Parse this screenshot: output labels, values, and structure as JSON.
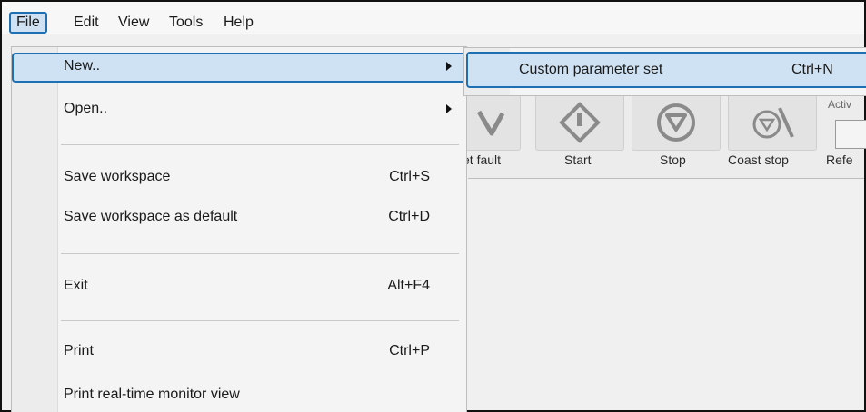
{
  "menubar": {
    "items": [
      "File",
      "Edit",
      "View",
      "Tools",
      "Help"
    ]
  },
  "file_menu": {
    "new": {
      "label": "New..",
      "has_submenu": true
    },
    "open": {
      "label": "Open..",
      "has_submenu": true
    },
    "save_workspace": {
      "label": "Save workspace",
      "shortcut": "Ctrl+S"
    },
    "save_default": {
      "label": "Save workspace as default",
      "shortcut": "Ctrl+D"
    },
    "exit": {
      "label": "Exit",
      "shortcut": "Alt+F4"
    },
    "print": {
      "label": "Print",
      "shortcut": "Ctrl+P"
    },
    "print_monitor": {
      "label": "Print real-time monitor view"
    }
  },
  "new_submenu": {
    "item": {
      "label": "Custom parameter set",
      "shortcut": "Ctrl+N"
    }
  },
  "toolbar": {
    "buttons": [
      {
        "label": "et fault",
        "icon": "reset-fault-icon"
      },
      {
        "label": "Start",
        "icon": "start-icon"
      },
      {
        "label": "Stop",
        "icon": "stop-icon"
      },
      {
        "label": "Coast stop",
        "icon": "coast-stop-icon"
      },
      {
        "label": "Refe",
        "icon": ""
      }
    ],
    "active_label": "Activ"
  },
  "colors": {
    "highlight_bg": "#cfe2f3",
    "highlight_border": "#1f6fb3",
    "menu_bg": "#f4f4f4"
  }
}
